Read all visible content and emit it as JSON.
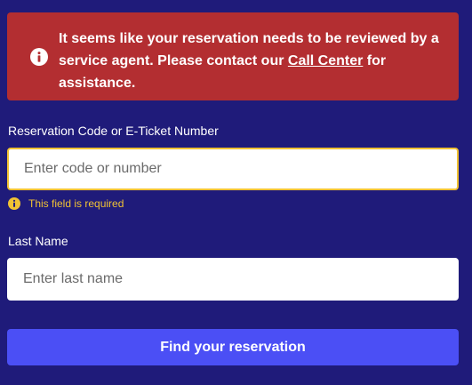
{
  "alert": {
    "text_before": "It seems like your reservation needs to be reviewed by a service agent. Please contact our ",
    "link_text": "Call Center",
    "text_after": " for assistance.",
    "icon": "info-icon",
    "color": "#b32e31"
  },
  "form": {
    "code_label": "Reservation Code or E-Ticket Number",
    "code_placeholder": "Enter code or number",
    "code_value": "",
    "code_error": "This field is required",
    "last_name_label": "Last Name",
    "last_name_placeholder": "Enter last name",
    "last_name_value": "",
    "submit_label": "Find your reservation"
  },
  "colors": {
    "background": "#1f1b7a",
    "error": "#f1c234",
    "button": "#4b4ff5"
  }
}
